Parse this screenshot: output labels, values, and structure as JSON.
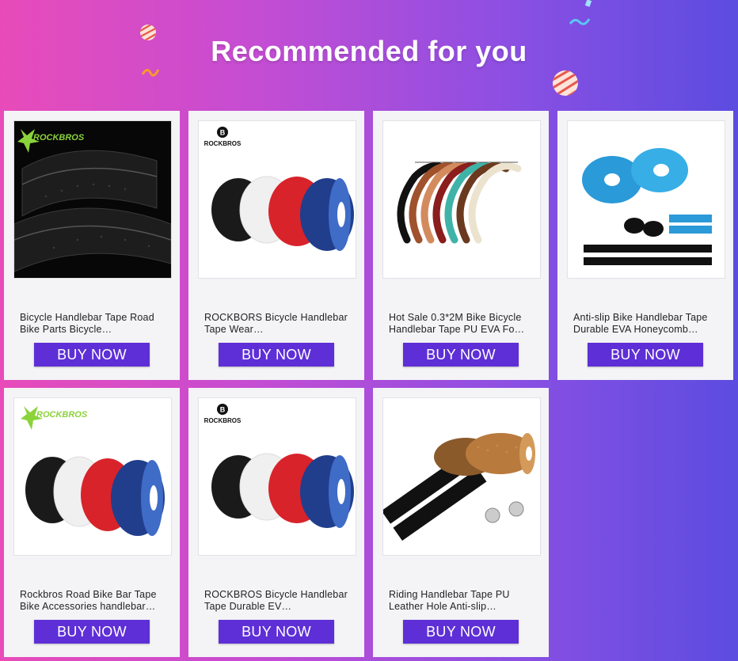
{
  "header": {
    "title": "Recommended for you"
  },
  "buy_label": "BUY NOW",
  "products": [
    {
      "name": "Bicycle Handlebar Tape Road Bike Parts Bicycle…",
      "image": "black-tape-rockbros"
    },
    {
      "name": "ROCKBORS Bicycle Handlebar Tape Wear…",
      "image": "four-color-tape-rolls"
    },
    {
      "name": "Hot Sale 0.3*2M Bike Bicycle Handlebar Tape PU EVA Fo…",
      "image": "multicolor-handlebars"
    },
    {
      "name": "Anti-slip Bike Handlebar Tape Durable EVA Honeycomb…",
      "image": "blue-honeycomb-tape"
    },
    {
      "name": "Rockbros Road Bike Bar Tape Bike Accessories handlebar…",
      "image": "four-color-tape-rolls-rockbros"
    },
    {
      "name": "ROCKBROS Bicycle Handlebar Tape Durable EV…",
      "image": "four-color-tape-rolls"
    },
    {
      "name": "Riding Handlebar Tape PU Leather Hole Anti-slip…",
      "image": "brown-leather-tape"
    }
  ],
  "brand": {
    "rockbros_text": "ROCKBROS",
    "logo_letter": "B"
  },
  "colors": {
    "button": "#5e2fd6",
    "accent_green": "#8bd33a"
  }
}
